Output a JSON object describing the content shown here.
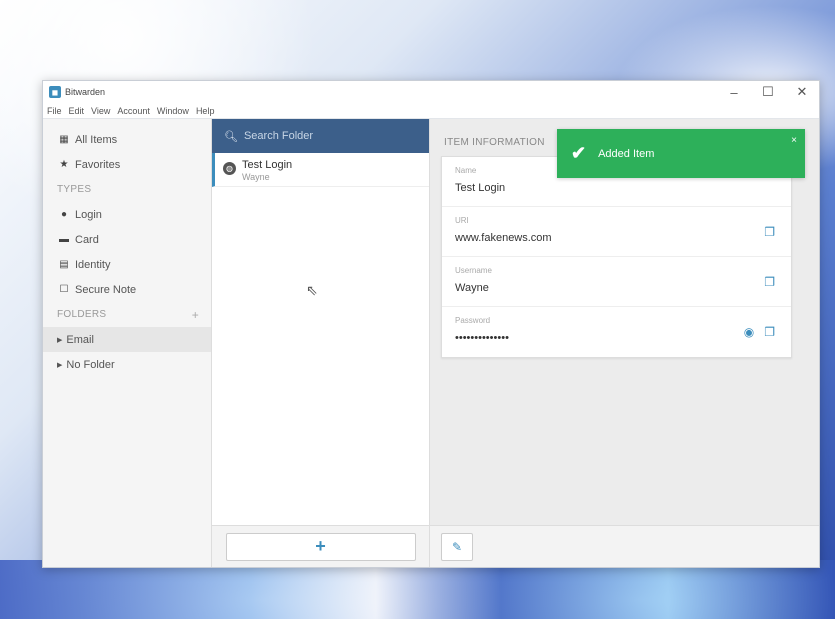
{
  "window": {
    "title": "Bitwarden",
    "controls": {
      "minimize": "–",
      "maximize": "☐",
      "close": "✕"
    }
  },
  "menubar": [
    "File",
    "Edit",
    "View",
    "Account",
    "Window",
    "Help"
  ],
  "sidebar": {
    "all_items": "All Items",
    "favorites": "Favorites",
    "types_heading": "TYPES",
    "types": [
      "Login",
      "Card",
      "Identity",
      "Secure Note"
    ],
    "folders_heading": "FOLDERS",
    "folders_add": "+",
    "folders": [
      "Email",
      "No Folder"
    ]
  },
  "list": {
    "search_placeholder": "Search Folder",
    "items": [
      {
        "title": "Test Login",
        "subtitle": "Wayne"
      }
    ],
    "add_button": "+"
  },
  "detail": {
    "section_title": "ITEM INFORMATION",
    "fields": [
      {
        "label": "Name",
        "value": "Test Login"
      },
      {
        "label": "URI",
        "value": "www.fakenews.com"
      },
      {
        "label": "Username",
        "value": "Wayne"
      },
      {
        "label": "Password",
        "value": "••••••••••••••"
      }
    ],
    "edit_button_icon": "pencil-icon"
  },
  "toast": {
    "message": "Added Item",
    "close": "×",
    "color": "#2db05a"
  },
  "colors": {
    "accent": "#3c8dbc",
    "search_bar": "#3c5f8a"
  }
}
